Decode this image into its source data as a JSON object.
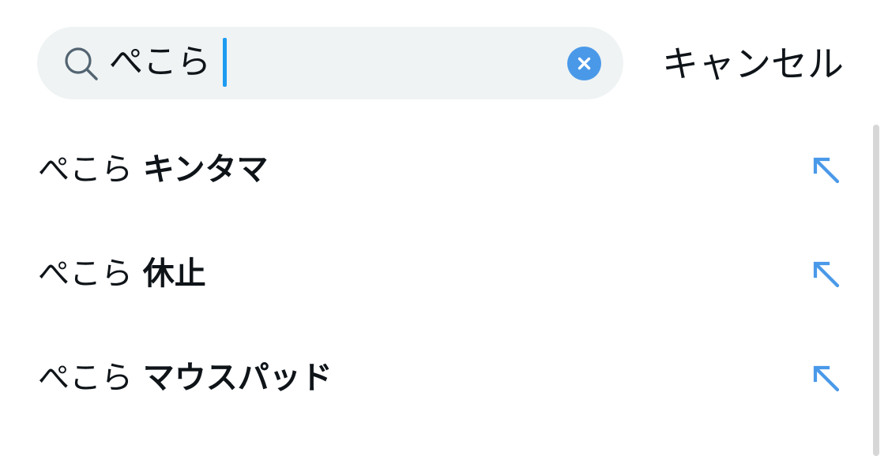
{
  "search": {
    "query": "ぺこら",
    "cancel_label": "キャンセル"
  },
  "suggestions": [
    {
      "prefix": "ぺこら",
      "completion": "キンタマ"
    },
    {
      "prefix": "ぺこら",
      "completion": "休止"
    },
    {
      "prefix": "ぺこら",
      "completion": "マウスパッド"
    }
  ],
  "colors": {
    "accent": "#1d9bf0",
    "search_bg": "#eff3f4",
    "text": "#0f1419",
    "arrow": "#4a99e9"
  },
  "icons": {
    "search": "search-icon",
    "clear": "clear-icon",
    "fill_suggestion": "arrow-up-left-icon"
  }
}
